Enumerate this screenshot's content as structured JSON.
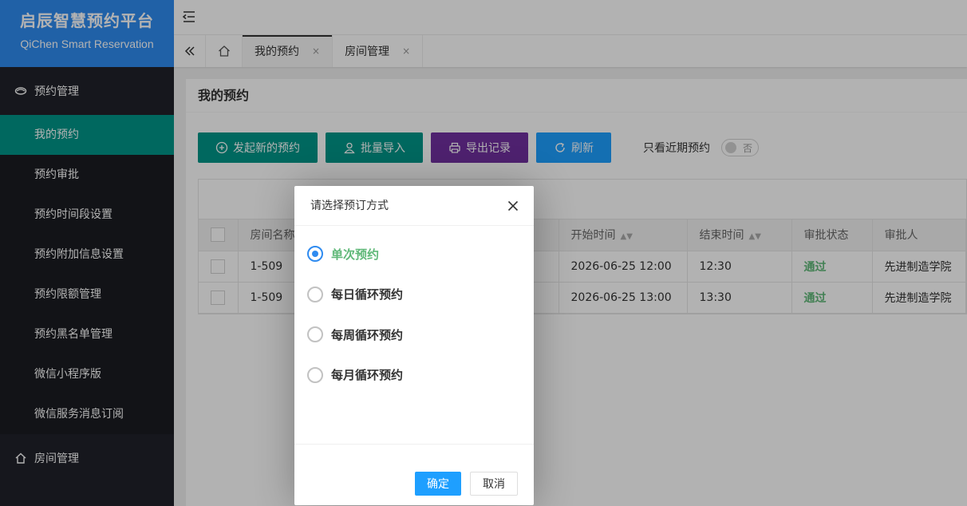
{
  "brand": {
    "title": "启辰智慧预约平台",
    "subtitle": "QiChen Smart Reservation"
  },
  "sidebar": {
    "group1": {
      "label": "预约管理",
      "icon": "eye-icon"
    },
    "items": [
      {
        "label": "我的预约",
        "active": true
      },
      {
        "label": "预约审批"
      },
      {
        "label": "预约时间段设置"
      },
      {
        "label": "预约附加信息设置"
      },
      {
        "label": "预约限额管理"
      },
      {
        "label": "预约黑名单管理"
      },
      {
        "label": "微信小程序版"
      },
      {
        "label": "微信服务消息订阅"
      }
    ],
    "group2": {
      "label": "房间管理",
      "icon": "home-icon"
    }
  },
  "tabs": [
    {
      "label": "我的预约",
      "close": "×"
    },
    {
      "label": "房间管理",
      "close": "×"
    }
  ],
  "page": {
    "title": "我的预约",
    "buttons": {
      "new": "发起新的预约",
      "import": "批量导入",
      "export": "导出记录",
      "refresh": "刷新"
    },
    "switch_label": "只看近期预约",
    "switch_value": "否"
  },
  "table": {
    "headers": {
      "room": "房间名称",
      "start": "开始时间",
      "end": "结束时间",
      "status": "审批状态",
      "approver": "审批人"
    },
    "rows": [
      {
        "room": "1-509",
        "start": "2026-06-25 12:00",
        "end": "12:30",
        "status": "通过",
        "approver": "先进制造学院"
      },
      {
        "room": "1-509",
        "start": "2026-06-25 13:00",
        "end": "13:30",
        "status": "通过",
        "approver": "先进制造学院"
      }
    ]
  },
  "dialog": {
    "title": "请选择预订方式",
    "options": [
      {
        "label": "单次预约",
        "checked": true
      },
      {
        "label": "每日循环预约"
      },
      {
        "label": "每周循环预约"
      },
      {
        "label": "每月循环预约"
      }
    ],
    "ok": "确定",
    "cancel": "取消"
  },
  "colors": {
    "primary": "#2f8bf0",
    "teal": "#009688",
    "purple": "#7030a0",
    "blue": "#1e9fff",
    "sidebar": "#20222a"
  }
}
